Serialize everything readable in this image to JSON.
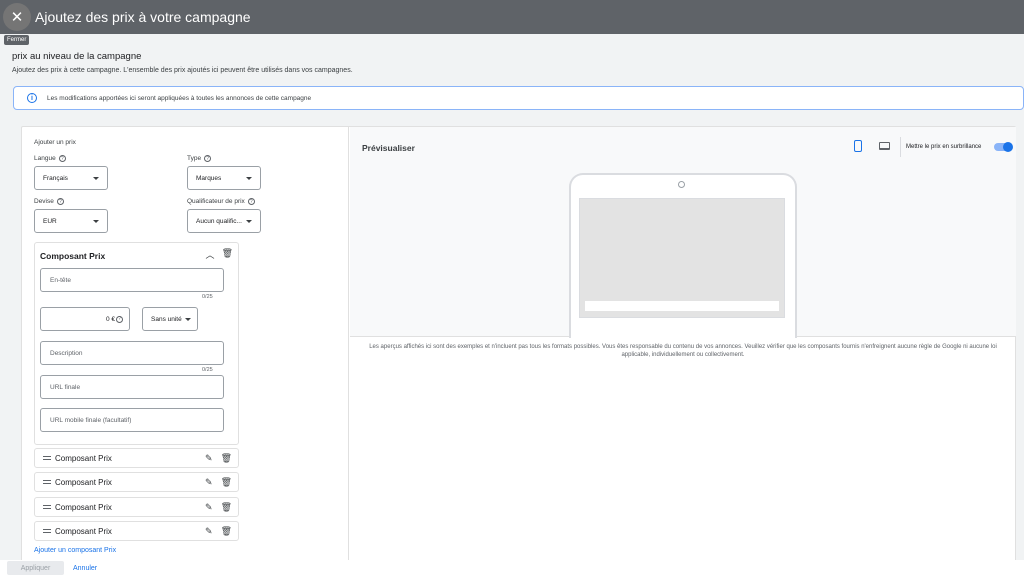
{
  "header": {
    "title": "Ajoutez des prix à votre campagne",
    "close_tooltip": "Fermer"
  },
  "section": {
    "title": "prix au niveau de la campagne",
    "subtitle": "Ajoutez des prix à cette campagne. L'ensemble des prix ajoutés ici peuvent être utilisés dans vos campagnes."
  },
  "banner": {
    "text": "Les modifications apportées ici seront appliquées à toutes les annonces de cette campagne"
  },
  "form": {
    "heading": "Ajouter un prix",
    "language": {
      "label": "Langue",
      "value": "Français"
    },
    "type": {
      "label": "Type",
      "value": "Marques"
    },
    "currency": {
      "label": "Devise",
      "value": "EUR"
    },
    "qualifier": {
      "label": "Qualificateur de prix",
      "value": "Aucun qualific..."
    }
  },
  "component": {
    "title": "Composant Prix",
    "header_placeholder": "En-tête",
    "header_counter": "0/25",
    "price_value": "0 €",
    "unit_value": "Sans unité",
    "description_placeholder": "Description",
    "description_counter": "0/25",
    "final_url_placeholder": "URL finale",
    "mobile_url_placeholder": "URL mobile finale (facultatif)"
  },
  "collapsed_components": [
    {
      "label": "Composant Prix"
    },
    {
      "label": "Composant Prix"
    },
    {
      "label": "Composant Prix"
    },
    {
      "label": "Composant Prix"
    }
  ],
  "add_component_label": "Ajouter un composant Prix",
  "preview": {
    "title": "Prévisualiser",
    "toggle_label": "Mettre le prix en surbrillance",
    "toggle_on": true,
    "disclaimer": "Les aperçus affichés ici sont des exemples et n'incluent pas tous les formats possibles. Vous êtes responsable du contenu de vos annonces. Veuillez vérifier que les composants fournis n'enfreignent aucune règle de Google ni aucune loi applicable, individuellement ou collectivement."
  },
  "footer": {
    "apply_label": "Appliquer",
    "cancel_label": "Annuler"
  },
  "colors": {
    "accent": "#1a73e8",
    "topbar": "#5f6368"
  }
}
